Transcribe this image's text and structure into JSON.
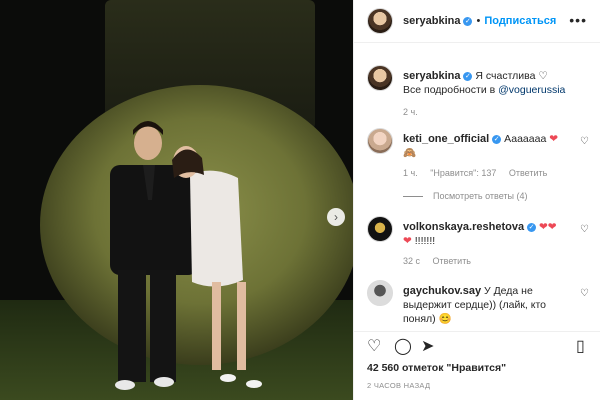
{
  "header": {
    "username": "seryabkina",
    "follow_label": "Подписаться",
    "separator": "•",
    "more_icon": "more-horizontal-icon"
  },
  "caption": {
    "username": "seryabkina",
    "text_line1": "Я счастлива ♡",
    "text_prefix": "Все подробности в ",
    "mention": "@voguerussia",
    "time": "2 ч."
  },
  "comments": [
    {
      "username": "keti_one_official",
      "text": "Ааааааа",
      "time": "1 ч.",
      "likes": "\"Нравится\": 137",
      "reply_label": "Ответить"
    },
    {
      "username": "volkonskaya.reshetova",
      "text": "!!!!!!!",
      "time": "32 с",
      "reply_label": "Ответить"
    },
    {
      "username": "gaychukov.say",
      "text": "У Деда не выдержит сердце)) (лайк, кто понял)"
    }
  ],
  "view_replies": "Посмотреть ответы (4)",
  "likes_text": "42 560 отметок \"Нравится\"",
  "timestamp": "2 ЧАСОВ НАЗАД",
  "colors": {
    "accent": "#0095f6",
    "verified": "#3897f0",
    "heart": "#ed4956",
    "muted": "#8e8e8e"
  }
}
